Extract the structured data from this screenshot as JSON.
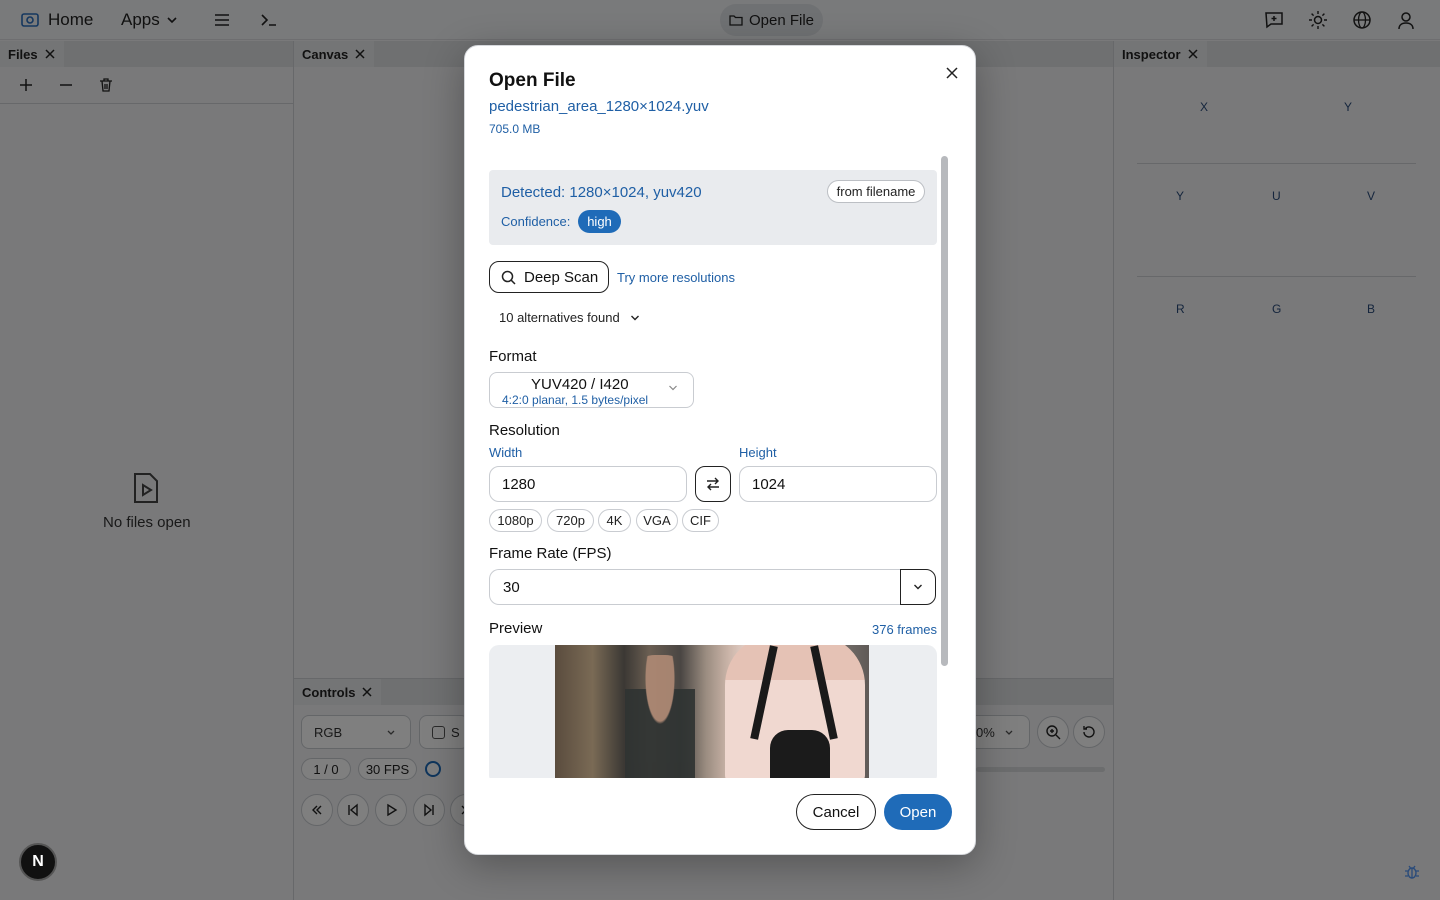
{
  "topbar": {
    "home_label": "Home",
    "apps_label": "Apps",
    "open_file_label": "Open File"
  },
  "panels": {
    "files": {
      "tab": "Files",
      "empty_text": "No files open"
    },
    "canvas": {
      "tab": "Canvas"
    },
    "inspector": {
      "tab": "Inspector",
      "row1": [
        "X",
        "Y"
      ],
      "row2": [
        "Y",
        "U",
        "V"
      ],
      "row3": [
        "R",
        "G",
        "B"
      ]
    },
    "controls": {
      "tab": "Controls",
      "mode_select": "RGB",
      "checkbox_label_partial": "S",
      "frame_counter": "1 / 0",
      "fps_pill": "30 FPS",
      "zoom_value_partial": "0%"
    }
  },
  "dialog": {
    "title": "Open File",
    "filename": "pedestrian_area_1280×1024.yuv",
    "filesize": "705.0 MB",
    "detected": "Detected: 1280×1024, yuv420",
    "detected_source": "from filename",
    "confidence_label": "Confidence:",
    "confidence_value": "high",
    "deep_scan_label": "Deep Scan",
    "try_more_label": "Try more resolutions",
    "alternatives_label": "10 alternatives found",
    "format_label": "Format",
    "format_value": "YUV420 / I420",
    "format_desc": "4:2:0 planar, 1.5 bytes/pixel",
    "resolution_label": "Resolution",
    "width_label": "Width",
    "width_value": "1280",
    "height_label": "Height",
    "height_value": "1024",
    "presets": [
      "1080p",
      "720p",
      "4K",
      "VGA",
      "CIF"
    ],
    "fps_label": "Frame Rate (FPS)",
    "fps_value": "30",
    "preview_label": "Preview",
    "frames_count": "376 frames",
    "cancel_label": "Cancel",
    "open_label": "Open"
  },
  "badge": {
    "next_letter": "N"
  },
  "colors": {
    "accent": "#1f6bb8",
    "link": "#1f5fa5"
  }
}
